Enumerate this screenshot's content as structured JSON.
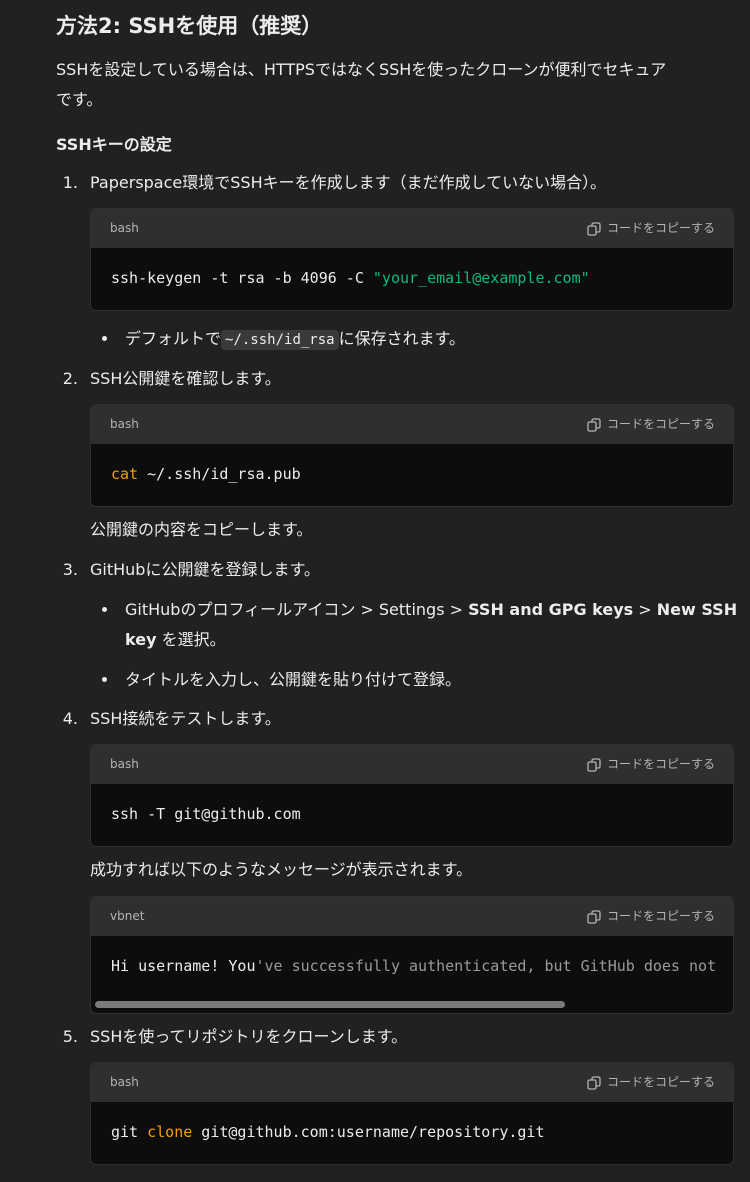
{
  "heading": "方法2: SSHを使用（推奨）",
  "intro": "SSHを設定している場合は、HTTPSではなくSSHを使ったクローンが便利でセキュアです。",
  "intro_line1": "SSHを設定している場合は、HTTPSではなくSSHを使ったクローンが便利でセキュア",
  "intro_line2": "です。",
  "subheading": "SSHキーの設定",
  "copy_label": "コードをコピーする",
  "steps": [
    {
      "number": "1.",
      "text": "Paperspace環境でSSHキーを作成します（まだ作成していない場合）。",
      "code_lang": "bash",
      "code": {
        "cmd": "ssh-keygen -t rsa -b 4096 -C ",
        "str": "\"your_email@example.com\""
      },
      "bullet": {
        "pre": "デフォルトで",
        "code": "~/.ssh/id_rsa",
        "post": "に保存されます。"
      }
    },
    {
      "number": "2.",
      "text": "SSH公開鍵を確認します。",
      "code_lang": "bash",
      "code": {
        "kw": "cat",
        "rest": " ~/.ssh/id_rsa.pub"
      },
      "after": "公開鍵の内容をコピーします。"
    },
    {
      "number": "3.",
      "text": "GitHubに公開鍵を登録します。",
      "bullets": [
        {
          "pre": "GitHubのプロフィールアイコン > Settings > ",
          "b1": "SSH and GPG keys",
          "mid": " > ",
          "b2": "New SSH",
          "b3": "key",
          "post": " を選択。"
        },
        {
          "text": "タイトルを入力し、公開鍵を貼り付けて登録。"
        }
      ]
    },
    {
      "number": "4.",
      "text": "SSH接続をテストします。",
      "code_lang": "bash",
      "code": {
        "text": "ssh -T git@github.com"
      },
      "after": "成功すれば以下のようなメッセージが表示されます。",
      "code2_lang": "vbnet",
      "code2": {
        "a": "Hi username! You",
        "b": "'ve successfully authenticated, but GitHub does not"
      }
    },
    {
      "number": "5.",
      "text": "SSHを使ってリポジトリをクローンします。",
      "code_lang": "bash",
      "code": {
        "a": "git ",
        "kw": "clone",
        "b": " git@github.com:username/repository.git"
      }
    }
  ]
}
